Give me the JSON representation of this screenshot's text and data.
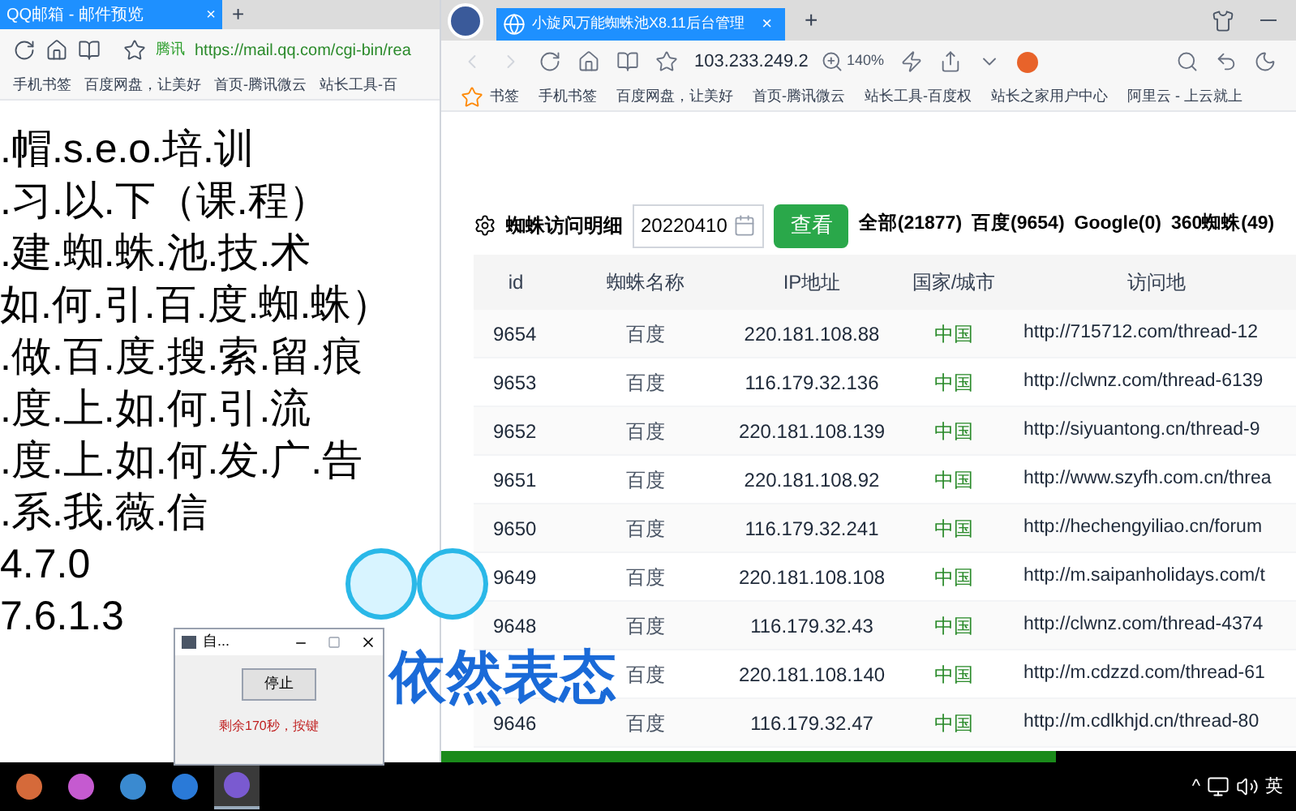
{
  "left_window": {
    "tab": {
      "title": "QQ邮箱 - 邮件预览",
      "close": "×"
    },
    "new_tab": "+",
    "address": {
      "site": "腾讯",
      "url": "https://mail.qq.com/cgi-bin/rea"
    },
    "bookmarks": [
      "手机书签",
      "百度网盘，让美好",
      "首页-腾讯微云",
      "站长工具-百"
    ],
    "lines": [
      ".帽.s.e.o.培.训",
      ".习.以.下（课.程）",
      ".建.蜘.蛛.池.技.术",
      "如.何.引.百.度.蜘.蛛）",
      ".做.百.度.搜.索.留.痕",
      ".度.上.如.何.引.流",
      ".度.上.如.何.发.广.告",
      ".系.我.薇.信",
      "4.7.0",
      "7.6.1.3"
    ]
  },
  "right_window": {
    "tab": {
      "title": "小旋风万能蜘蛛池X8.11后台管理",
      "close": "×"
    },
    "new_tab": "+",
    "address": "103.233.249.2",
    "zoom": "140%",
    "bookmarks": [
      "书签",
      "手机书签",
      "百度网盘，让美好",
      "首页-腾讯微云",
      "站长工具-百度权",
      "站长之家用户中心",
      "阿里云 - 上云就上"
    ],
    "toolbar": {
      "title": "蜘蛛访问明细",
      "date": "20220410",
      "button": "查看",
      "stats": [
        "全部(21877)",
        "百度(9654)",
        "Google(0)",
        "360蜘蛛(49)"
      ]
    },
    "table": {
      "columns": [
        "id",
        "蜘蛛名称",
        "IP地址",
        "国家/城市",
        "访问地"
      ],
      "rows": [
        {
          "id": "9654",
          "name": "百度",
          "ip": "220.181.108.88",
          "country": "中国",
          "url": "http://715712.com/thread-12"
        },
        {
          "id": "9653",
          "name": "百度",
          "ip": "116.179.32.136",
          "country": "中国",
          "url": "http://clwnz.com/thread-6139"
        },
        {
          "id": "9652",
          "name": "百度",
          "ip": "220.181.108.139",
          "country": "中国",
          "url": "http://siyuantong.cn/thread-9"
        },
        {
          "id": "9651",
          "name": "百度",
          "ip": "220.181.108.92",
          "country": "中国",
          "url": "http://www.szyfh.com.cn/threa"
        },
        {
          "id": "9650",
          "name": "百度",
          "ip": "116.179.32.241",
          "country": "中国",
          "url": "http://hechengyiliao.cn/forum"
        },
        {
          "id": "9649",
          "name": "百度",
          "ip": "220.181.108.108",
          "country": "中国",
          "url": "http://m.saipanholidays.com/t"
        },
        {
          "id": "9648",
          "name": "百度",
          "ip": "116.179.32.43",
          "country": "中国",
          "url": "http://clwnz.com/thread-4374"
        },
        {
          "name": "百度",
          "ip": "220.181.108.140",
          "country": "中国",
          "url": "http://m.cdzzd.com/thread-61"
        },
        {
          "id": "9646",
          "name": "百度",
          "ip": "116.179.32.47",
          "country": "中国",
          "url": "http://m.cdlkhjd.cn/thread-80"
        }
      ]
    },
    "progress": {
      "level": 0.72
    }
  },
  "dialog": {
    "title": "自...",
    "button": "停止",
    "message": "剩余170秒，按键"
  },
  "overlay_text": "依然表态",
  "taskbar": {
    "apps": [
      {
        "selected": false
      },
      {
        "selected": false
      },
      {
        "selected": false
      },
      {
        "selected": false
      },
      {
        "selected": true
      }
    ],
    "tray_caret": "^",
    "language": "英"
  }
}
